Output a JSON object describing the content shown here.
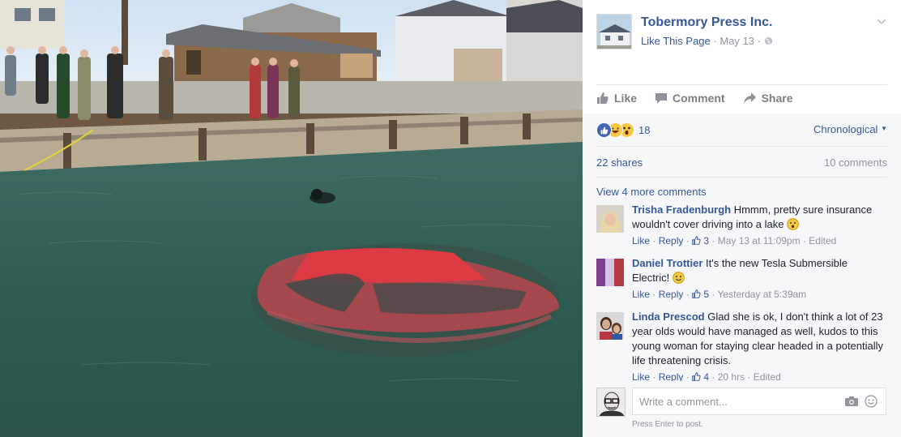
{
  "post": {
    "page_name": "Tobermory Press Inc.",
    "like_page": "Like This Page",
    "date": "May 13",
    "sep": "·"
  },
  "actions": {
    "like": "Like",
    "comment": "Comment",
    "share": "Share"
  },
  "stats": {
    "reaction_count": "18",
    "sort": "Chronological",
    "shares": "22 shares",
    "comments": "10 comments",
    "view_more": "View 4 more comments"
  },
  "comments": [
    {
      "name": "Trisha Fradenburgh",
      "text": "Hmmm, pretty sure insurance wouldn't cover driving into a lake",
      "like": "Like",
      "reply": "Reply",
      "likes": "3",
      "time": "May 13 at 11:09pm",
      "edited": "Edited"
    },
    {
      "name": "Daniel Trottier",
      "text": "It's the new Tesla Submersible Electric!",
      "like": "Like",
      "reply": "Reply",
      "likes": "5",
      "time": "Yesterday at 5:39am"
    },
    {
      "name": "Linda Prescod",
      "text": "Glad she is ok, I don't think a lot of 23 year olds would have managed as well, kudos to this young woman for staying clear headed in a potentially life threatening crisis.",
      "like": "Like",
      "reply": "Reply",
      "likes": "4",
      "time": "20 hrs",
      "edited": "Edited"
    }
  ],
  "composer": {
    "placeholder": "Write a comment...",
    "hint": "Press Enter to post."
  },
  "icons": {
    "like": "thumbs-up-icon",
    "comment": "speech-bubble-icon",
    "share": "share-arrow-icon",
    "globe": "globe-icon",
    "camera": "camera-icon",
    "emoji": "smiley-icon",
    "chevron": "chevron-down-icon"
  },
  "colors": {
    "link": "#365899",
    "meta": "#90949c",
    "panel": "#f6f7f9",
    "car": "#d8333a",
    "water": "#2f5a4e"
  }
}
